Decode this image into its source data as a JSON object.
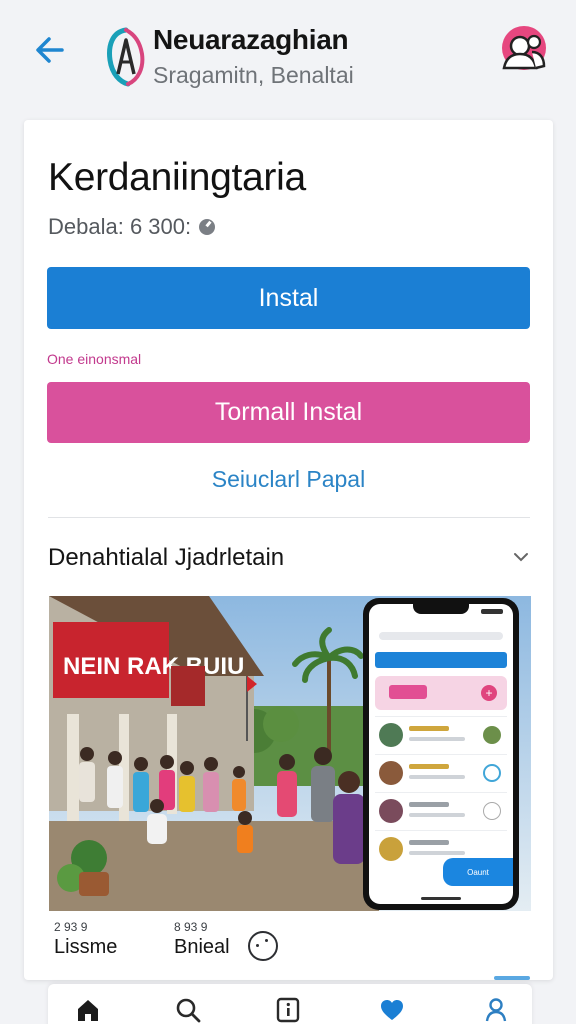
{
  "header": {
    "title": "Neuarazaghian",
    "subtitle": "Sragamitn, Benaltai",
    "back_icon": "arrow-left-icon",
    "logo_icon": "app-logo-icon",
    "profile_icon": "profile-icon"
  },
  "app": {
    "name": "Kerdaniingtaria",
    "meta": "Debala: 6 300:",
    "meta_icon": "check-circle-icon"
  },
  "buttons": {
    "install": "Instal",
    "secondary_label": "One einonsmal",
    "pink": "Tormall Instal",
    "link": "Seiuclarl Papal"
  },
  "section": {
    "title": "Denahtialal Jjadrletain",
    "toggle_icon": "chevron-down-icon"
  },
  "preview": {
    "banner_text": "NEIN RAK BUIU",
    "phone_cta": "Oaunt"
  },
  "stats": [
    {
      "number": "2 93 9",
      "label": "Lissme"
    },
    {
      "number": "8 93 9",
      "label": "Bnieal"
    }
  ],
  "bottom_nav": [
    {
      "icon": "home-icon"
    },
    {
      "icon": "search-icon"
    },
    {
      "icon": "info-icon"
    },
    {
      "icon": "heart-icon"
    },
    {
      "icon": "person-icon"
    }
  ],
  "colors": {
    "install": "#1b7fd4",
    "pink": "#d9519c",
    "link": "#2b84c6",
    "secondary_label": "#c2398d",
    "heart": "#1b7fd4"
  }
}
